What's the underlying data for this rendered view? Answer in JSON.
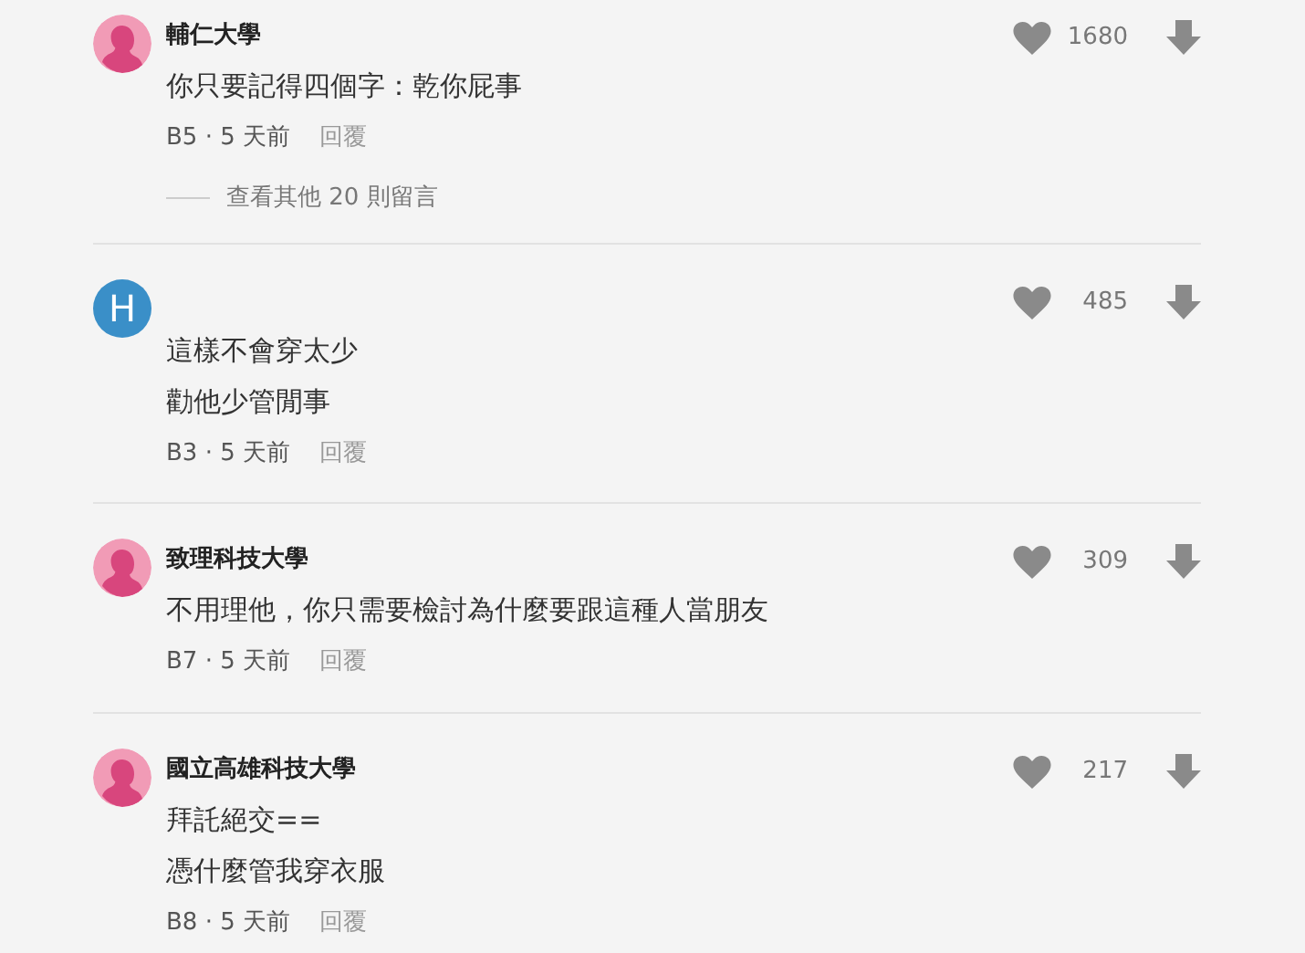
{
  "comments": [
    {
      "author": "輔仁大學",
      "avatar": {
        "kind": "silhouette"
      },
      "lines": [
        "你只要記得四個字：乾你屁事"
      ],
      "meta": "B5 · 5 天前",
      "reply": "回覆",
      "likes": "1680",
      "more_replies": "查看其他 20 則留言"
    },
    {
      "avatar": {
        "kind": "letter",
        "letter": "H"
      },
      "lines": [
        "這樣不會穿太少",
        "勸他少管閒事"
      ],
      "meta": "B3 · 5 天前",
      "reply": "回覆",
      "likes": "485"
    },
    {
      "author": "致理科技大學",
      "avatar": {
        "kind": "silhouette"
      },
      "lines": [
        "不用理他，你只需要檢討為什麼要跟這種人當朋友"
      ],
      "meta": "B7 · 5 天前",
      "reply": "回覆",
      "likes": "309"
    },
    {
      "author": "國立高雄科技大學",
      "avatar": {
        "kind": "silhouette"
      },
      "lines": [
        "拜託絕交==",
        "憑什麼管我穿衣服"
      ],
      "meta": "B8 · 5 天前",
      "reply": "回覆",
      "likes": "217"
    }
  ]
}
